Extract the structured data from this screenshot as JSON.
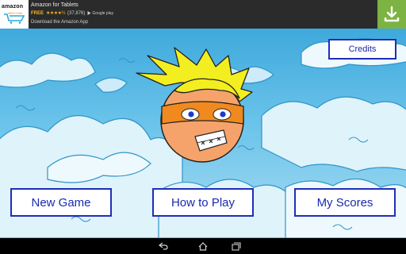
{
  "ad": {
    "logo_text": "amazon",
    "title": "Amazon for Tablets",
    "price": "FREE",
    "stars": "★★★★½",
    "rating_count": "(37,876)",
    "store_label": "Google play",
    "subtitle": "Download the Amazon App",
    "icons": {
      "logo": "amazon-cart-logo",
      "download": "download-icon"
    },
    "colors": {
      "download_bg": "#7cb342",
      "price": "#f5b324"
    }
  },
  "menu": {
    "credits_label": "Credits",
    "new_game_label": "New Game",
    "how_to_play_label": "How to Play",
    "my_scores_label": "My Scores"
  },
  "character": {
    "description_icon": "masked-boy-head"
  },
  "navbar": {
    "icons": [
      "back-icon",
      "home-icon",
      "recent-apps-icon"
    ]
  },
  "colors": {
    "button_border": "#1e2fb8",
    "button_text": "#1a2ab0",
    "sky": "#3fa9dc",
    "mask": "#f08a1e",
    "hair": "#f3ee1f",
    "face": "#f5a36b"
  }
}
